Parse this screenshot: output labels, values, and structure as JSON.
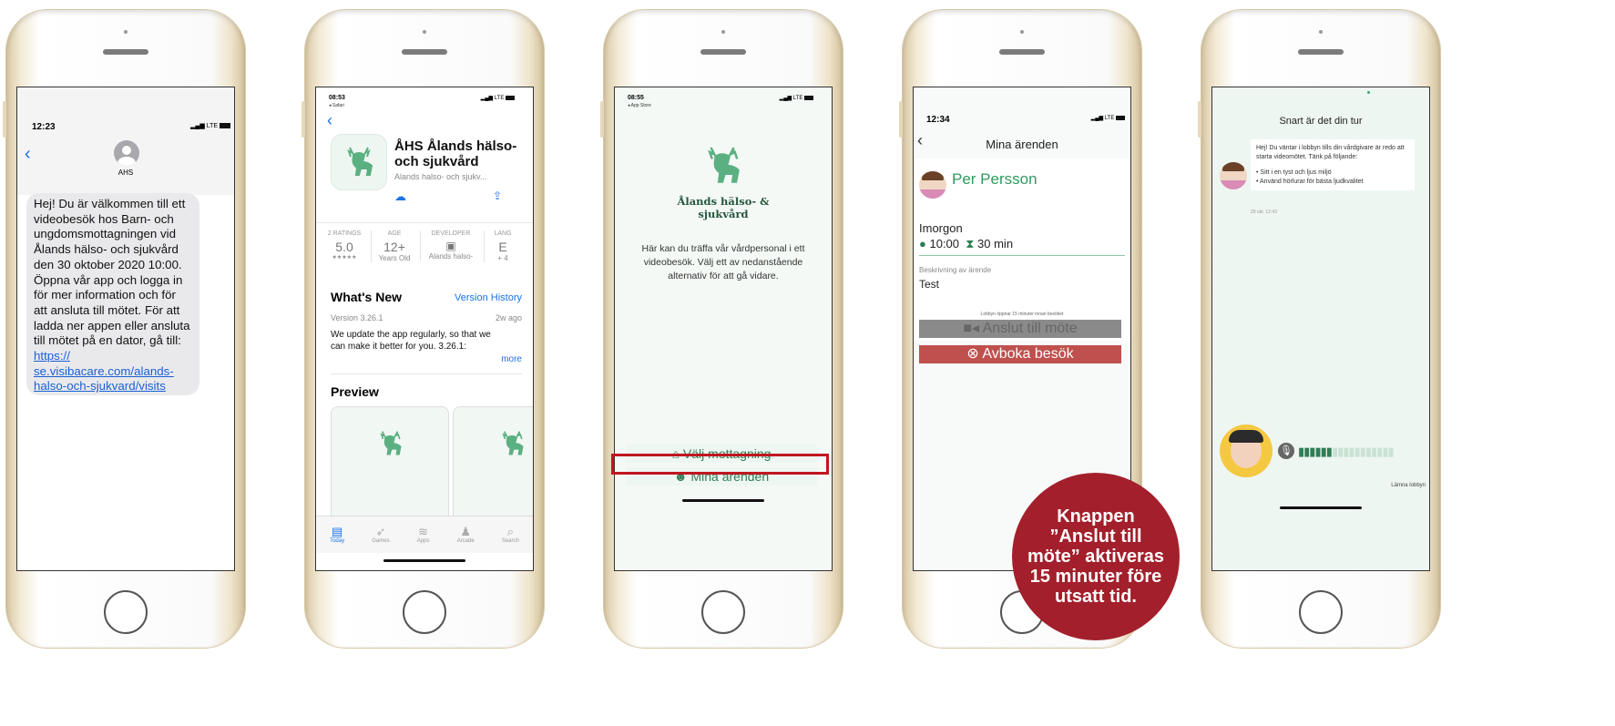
{
  "phone1": {
    "time": "12:23",
    "signal": "LTE",
    "sender": "AHS",
    "message": "Hej! Du är välkommen till ett videobesök hos Barn- och ungdomsmottagningen vid Ålands hälso- och sjukvård den 30 oktober 2020 10:00. Öppna vår app och logga in för mer information och för att ansluta till mötet. För att ladda ner appen eller dator, gå till: ",
    "message_start": "Hej! Du är välkommen till ett videobesök hos Barn- och ungdomsmottagningen vid Ålands hälso- och sjukvård den 30 oktober 2020 10:00. Öppna vår app och logga in för mer information och för att ansluta till mötet. För att ladda ner appen eller ansluta till mötet på en dator, gå till: ",
    "link": "https:// se.visibacare.com/alands-halso-och-sjukvard/visits"
  },
  "phone2": {
    "time": "08:53",
    "back_label": "◂ Safari",
    "signal": "LTE",
    "app_name": "ÅHS Ålands hälso- och sjukvård",
    "app_subtitle": "Alands halso- och sjukv...",
    "stats": [
      {
        "label": "2 RATINGS",
        "value": "5.0",
        "sub": "★★★★★"
      },
      {
        "label": "AGE",
        "value": "12+",
        "sub": "Years Old"
      },
      {
        "label": "DEVELOPER",
        "value": "",
        "sub": "Alands halso-"
      },
      {
        "label": "LANG",
        "value": "E",
        "sub": "+ 4"
      }
    ],
    "whats_new": "What's New",
    "version_history": "Version History",
    "version": "Version 3.26.1",
    "ago": "2w ago",
    "update_text": "We update the app regularly, so that we can make it better for you. 3.26.1:",
    "more": "more",
    "preview": "Preview",
    "tabs": [
      "Today",
      "Games",
      "Apps",
      "Arcade",
      "Search"
    ]
  },
  "phone3": {
    "time": "08:55",
    "back_label": "◂ App Store",
    "signal": "LTE",
    "logo_text": "Ålands hälso- & sjukvård",
    "intro": "Här kan du träffa vår vårdpersonal i ett videobesök. Välj ett av nedanstående alternativ för att gå vidare.",
    "btn1": "Välj mottagning",
    "btn2": "Mina ärenden"
  },
  "phone4": {
    "time": "12:34",
    "signal": "LTE",
    "title": "Mina ärenden",
    "name": "Per Persson",
    "when": "Imorgon",
    "clock": "10:00",
    "duration": "30 min",
    "desc_label": "Beskrivning av ärende",
    "desc": "Test",
    "lobby_note": "Lobbyn öppnar 15 minuter innan besöket",
    "join": "Anslut till möte",
    "cancel": "Avboka besök"
  },
  "phone5": {
    "title": "Snart är det din tur",
    "msg1": "Hej! Du väntar i lobbyn tills din vårdgivare är redo att starta videomötet. Tänk på följande:",
    "bullet1": "• Sitt i en tyst och ljus miljö",
    "bullet2": "• Använd hörlurar för bästa ljudkvalitet",
    "timestamp": "29 okt. 12:43",
    "leave": "Lämna lobbyn"
  },
  "callout": "Knappen ”Anslut till möte” aktiveras 15 minuter före utsatt tid.",
  "colors": {
    "green": "#2f7d55",
    "highlight": "#c0161f",
    "callout": "#a31f2b"
  }
}
